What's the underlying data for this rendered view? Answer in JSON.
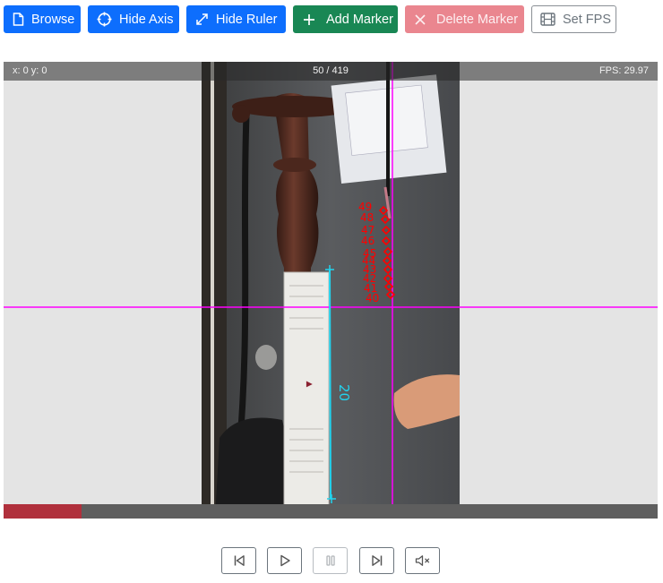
{
  "toolbar": {
    "browse_label": "Browse",
    "hide_axis_label": "Hide Axis",
    "hide_ruler_label": "Hide Ruler",
    "add_marker_label": "Add Marker",
    "delete_marker_label": "Delete Marker",
    "set_fps_label": "Set FPS"
  },
  "video": {
    "cursor_coords": "x: 0 y: 0",
    "frame_counter": "50 / 419",
    "fps_readout": "FPS: 29.97",
    "progress_fraction": 0.119,
    "ruler_label": "20"
  },
  "markers": [
    {
      "label": "40"
    },
    {
      "label": "41"
    },
    {
      "label": "42"
    },
    {
      "label": "43"
    },
    {
      "label": "44"
    },
    {
      "label": "45"
    },
    {
      "label": "46"
    },
    {
      "label": "47"
    },
    {
      "label": "48"
    },
    {
      "label": "49"
    }
  ],
  "colors": {
    "primary": "#0d6efd",
    "success": "#198754",
    "danger_disabled": "#ea868f",
    "axis": "#ff00ff",
    "ruler": "#22d3ee",
    "marker": "#ff0000",
    "progress": "#b0303c"
  },
  "icons": {
    "browse": "file-icon",
    "hide_axis": "crosshair-icon",
    "hide_ruler": "arrows-expand-icon",
    "add_marker": "plus-icon",
    "delete_marker": "x-icon",
    "set_fps": "film-icon",
    "skip_start": "skip-start-icon",
    "play": "play-icon",
    "pause": "pause-icon",
    "skip_end": "skip-end-icon",
    "mute": "volume-mute-icon"
  }
}
